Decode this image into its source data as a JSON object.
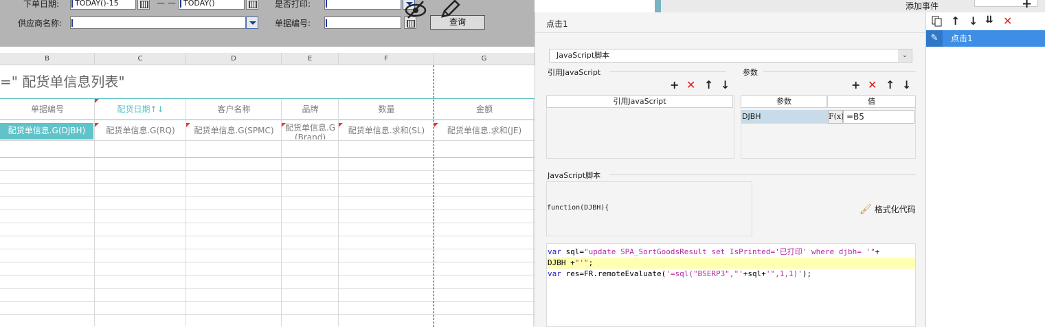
{
  "param_panel": {
    "order_date_label": "下单日期:",
    "order_date_from": "TODAY()-15",
    "date_separator": "— —",
    "order_date_to": "TODAY()",
    "printed_label": "是否打印:",
    "printed_value": "",
    "supplier_label": "供应商名称:",
    "supplier_value": "",
    "doc_no_label": "单据编号:",
    "doc_no_value": "",
    "query_button": "查询"
  },
  "sheet": {
    "columns": [
      "B",
      "C",
      "D",
      "E",
      "F",
      "G"
    ],
    "title": "=\"  配货单信息列表\"",
    "headers": [
      "单据编号",
      "配货日期↑↓",
      "客户名称",
      "品牌",
      "数量",
      "金额"
    ],
    "cells": [
      "配货单信息.G(DJBH)",
      "配货单信息.G(RQ)",
      "配货单信息.G(SPMC)",
      "配货单信息.G(Brand)",
      "配货单信息.求和(SL)",
      "配货单信息.求和(JE)"
    ],
    "accent_color": "#5fc3c9",
    "selected_cell_color": "#5fc3c9"
  },
  "event": {
    "title": "点击1",
    "type_select": "JavaScript脚本",
    "ref_js_section": "引用JavaScript",
    "ref_js_header": "引用JavaScript",
    "params_section": "参数",
    "param_col_name": "参数",
    "param_col_value": "值",
    "param_name": "DJBH",
    "fx_label": "F(x)",
    "param_value": "=B5",
    "script_section": "JavaScript脚本",
    "function_signature": "function(DJBH){",
    "format_code": "格式化代码",
    "code": {
      "l1_kw": "var",
      "l1_mid": " sql=",
      "l1_str": "\"update SPA_SortGoodsResult set IsPrinted='已打印' where djbh= '\"",
      "l1_end": "+",
      "l2_a": "DJBH +",
      "l2_str": "\"'\"",
      "l2_end": ";",
      "l3_kw": "var",
      "l3_mid": " res=FR.remoteEvaluate(",
      "l3_str": "'=sql(\"BSERP3\",\"'",
      "l3_mid2": "+sql+",
      "l3_str2": "'\",1,1)'",
      "l3_end": ");"
    }
  },
  "event_list": {
    "add_event_label": "添加事件",
    "items": [
      "点击1"
    ]
  },
  "icons": {
    "add": "plus-icon",
    "delete": "delete-icon",
    "up": "arrow-up-icon",
    "down": "arrow-down-icon",
    "copy": "copy-icon",
    "edit": "pencil-icon",
    "hide": "eye-slash-icon"
  }
}
